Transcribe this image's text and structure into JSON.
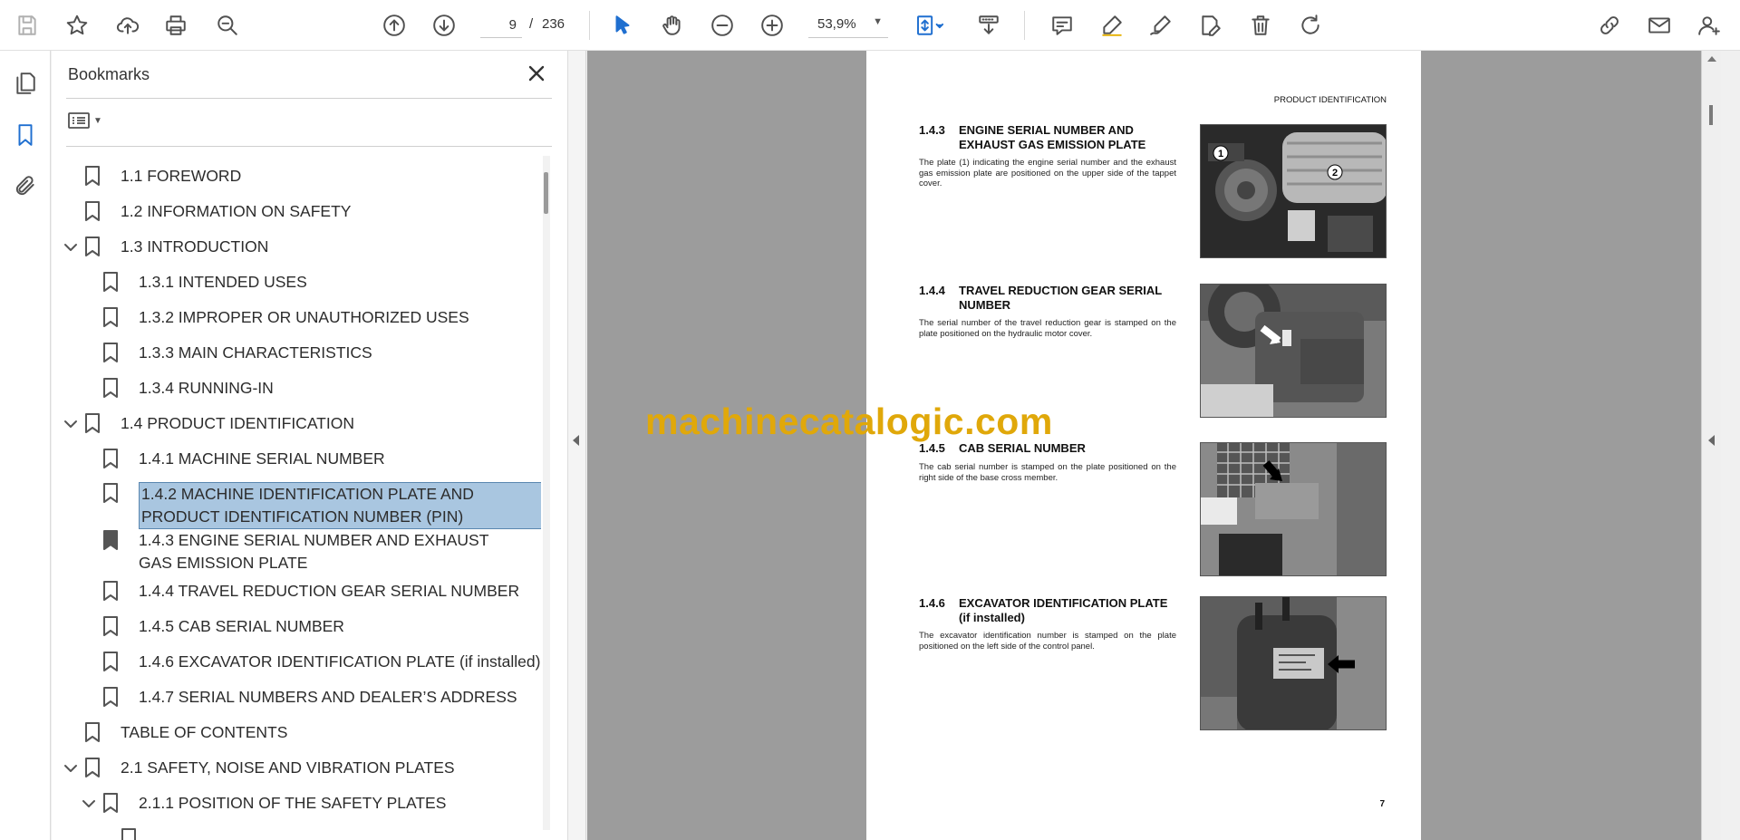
{
  "toolbar": {
    "page_current": "9",
    "page_separator": "/",
    "page_total": "236",
    "zoom": "53,9%"
  },
  "bookmarks_panel": {
    "title": "Bookmarks",
    "items": [
      {
        "label": "1.1 FOREWORD",
        "level": 0,
        "expandable": false
      },
      {
        "label": "1.2 INFORMATION ON SAFETY",
        "level": 0,
        "expandable": false
      },
      {
        "label": "1.3 INTRODUCTION",
        "level": 0,
        "expandable": true
      },
      {
        "label": "1.3.1 INTENDED USES",
        "level": 1,
        "expandable": false
      },
      {
        "label": "1.3.2 IMPROPER OR UNAUTHORIZED USES",
        "level": 1,
        "expandable": false
      },
      {
        "label": "1.3.3 MAIN CHARACTERISTICS",
        "level": 1,
        "expandable": false
      },
      {
        "label": "1.3.4 RUNNING-IN",
        "level": 1,
        "expandable": false
      },
      {
        "label": "1.4 PRODUCT IDENTIFICATION",
        "level": 0,
        "expandable": true
      },
      {
        "label": "1.4.1 MACHINE SERIAL NUMBER",
        "level": 1,
        "expandable": false
      },
      {
        "label": "1.4.2 MACHINE IDENTIFICATION PLATE AND PRODUCT IDENTIFICATION NUMBER (PIN)",
        "level": 1,
        "expandable": false,
        "selected": true
      },
      {
        "label": "1.4.3 ENGINE SERIAL NUMBER AND EXHAUST GAS EMISSION PLATE",
        "level": 1,
        "expandable": false
      },
      {
        "label": "1.4.4 TRAVEL REDUCTION GEAR SERIAL NUMBER",
        "level": 1,
        "expandable": false
      },
      {
        "label": "1.4.5 CAB SERIAL NUMBER",
        "level": 1,
        "expandable": false
      },
      {
        "label": "1.4.6 EXCAVATOR IDENTIFICATION PLATE (if installed)",
        "level": 1,
        "expandable": false
      },
      {
        "label": "1.4.7 SERIAL NUMBERS AND DEALER’S ADDRESS",
        "level": 1,
        "expandable": false
      },
      {
        "label": "TABLE OF CONTENTS",
        "level": 0,
        "expandable": false
      },
      {
        "label": "2.1 SAFETY, NOISE AND VIBRATION PLATES",
        "level": 0,
        "expandable": true
      },
      {
        "label": "2.1.1 POSITION OF THE SAFETY PLATES",
        "level": 1,
        "expandable": true
      }
    ]
  },
  "document": {
    "header": "PRODUCT IDENTIFICATION",
    "page_number": "7",
    "watermark": "machinecatalogic.com",
    "sections": [
      {
        "number": "1.4.3",
        "title": "ENGINE SERIAL NUMBER AND EXHAUST GAS EMISSION PLATE",
        "body": "The plate (1) indicating the engine serial number and the exhaust gas emission plate are positioned on the upper side of the tappet cover."
      },
      {
        "number": "1.4.4",
        "title": "TRAVEL REDUCTION GEAR SERIAL NUMBER",
        "body": "The serial number of the travel reduction gear is stamped on the plate positioned on the hydraulic motor cover."
      },
      {
        "number": "1.4.5",
        "title": "CAB SERIAL NUMBER",
        "body": "The cab serial number is stamped on the plate positioned on the right side of the base cross member."
      },
      {
        "number": "1.4.6",
        "title": "EXCAVATOR IDENTIFICATION PLATE (if installed)",
        "body": "The excavator identification number is stamped on the plate positioned on the left side of the control panel."
      }
    ],
    "photo_callouts": [
      "1",
      "2"
    ]
  }
}
